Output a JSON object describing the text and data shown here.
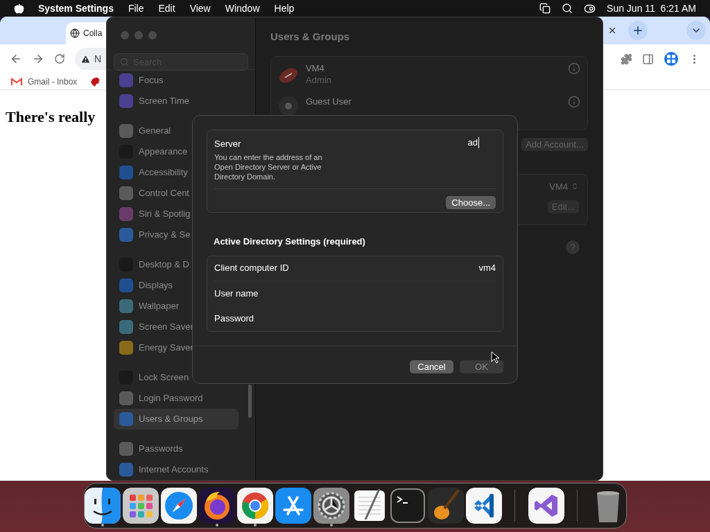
{
  "menu_bar": {
    "app": "System Settings",
    "menus": [
      "File",
      "Edit",
      "View",
      "Window",
      "Help"
    ],
    "clock": "Sun Jun 11  6:21 AM"
  },
  "browser": {
    "tab_title": "Colla",
    "address": "N",
    "bookmarks": [
      "Gmail - Inbox"
    ],
    "heading": "There's really"
  },
  "settings": {
    "search_placeholder": "Search",
    "title": "Users & Groups",
    "sidebar_groups": [
      [
        {
          "label": "Focus",
          "selected": false,
          "color": "#4b3f8f"
        },
        {
          "label": "Screen Time",
          "selected": false,
          "color": "#4b3f8f"
        }
      ],
      [
        {
          "label": "General",
          "selected": false,
          "color": "#5a5a5a"
        },
        {
          "label": "Appearance",
          "selected": false,
          "color": "#1a1a1a"
        },
        {
          "label": "Accessibility",
          "selected": false,
          "color": "#1f4f8f"
        },
        {
          "label": "Control Cent",
          "selected": false,
          "color": "#5a5a5a"
        },
        {
          "label": "Siri & Spotlig",
          "selected": false,
          "color": "#6a3a6a"
        },
        {
          "label": "Privacy & Se",
          "selected": false,
          "color": "#2a5a9a"
        }
      ],
      [
        {
          "label": "Desktop & D",
          "selected": false,
          "color": "#1a1a1a"
        },
        {
          "label": "Displays",
          "selected": false,
          "color": "#1f4f8f"
        },
        {
          "label": "Wallpaper",
          "selected": false,
          "color": "#3a6a7a"
        },
        {
          "label": "Screen Saver",
          "selected": false,
          "color": "#3a6a7a"
        },
        {
          "label": "Energy Saver",
          "selected": false,
          "color": "#8a6a1a"
        }
      ],
      [
        {
          "label": "Lock Screen",
          "selected": false,
          "color": "#1a1a1a"
        },
        {
          "label": "Login Password",
          "selected": false,
          "color": "#5a5a5a"
        },
        {
          "label": "Users & Groups",
          "selected": true,
          "color": "#2a5a9a"
        }
      ],
      [
        {
          "label": "Passwords",
          "selected": false,
          "color": "#5a5a5a"
        },
        {
          "label": "Internet Accounts",
          "selected": false,
          "color": "#2a5a9a"
        }
      ]
    ],
    "users": [
      {
        "name": "VM4",
        "role": "Admin",
        "kind": "football"
      },
      {
        "name": "Guest User",
        "kind": "guest"
      }
    ],
    "add_account": "Add Account...",
    "login_user": "VM4",
    "edit": "Edit...",
    "help": "?"
  },
  "sheet": {
    "server_label": "Server",
    "server_help": "You can enter the address of an Open Directory Server or Active Directory Domain.",
    "server_value": "ad",
    "choose": "Choose...",
    "section_title": "Active Directory Settings (required)",
    "fields": [
      {
        "label": "Client computer ID",
        "value": "vm4"
      },
      {
        "label": "User name"
      },
      {
        "label": "Password"
      }
    ],
    "buttons": [
      {
        "label": "Cancel",
        "disabled": false
      },
      {
        "label": "OK",
        "disabled": true
      }
    ]
  },
  "dock": [
    {
      "kind": "finder",
      "running": true
    },
    {
      "kind": "launchpad",
      "running": false
    },
    {
      "kind": "safari",
      "running": false
    },
    {
      "kind": "firefox",
      "running": true
    },
    {
      "kind": "chrome",
      "running": true
    },
    {
      "kind": "appstore",
      "running": false
    },
    {
      "kind": "settings",
      "running": true
    },
    {
      "kind": "textedit",
      "running": false
    },
    {
      "kind": "terminal",
      "running": false
    },
    {
      "kind": "garageband",
      "running": false
    },
    {
      "kind": "vscode",
      "running": false
    },
    {
      "kind": "separator"
    },
    {
      "kind": "visualstudio",
      "running": false
    },
    {
      "kind": "separator"
    },
    {
      "kind": "trash",
      "running": false
    }
  ]
}
